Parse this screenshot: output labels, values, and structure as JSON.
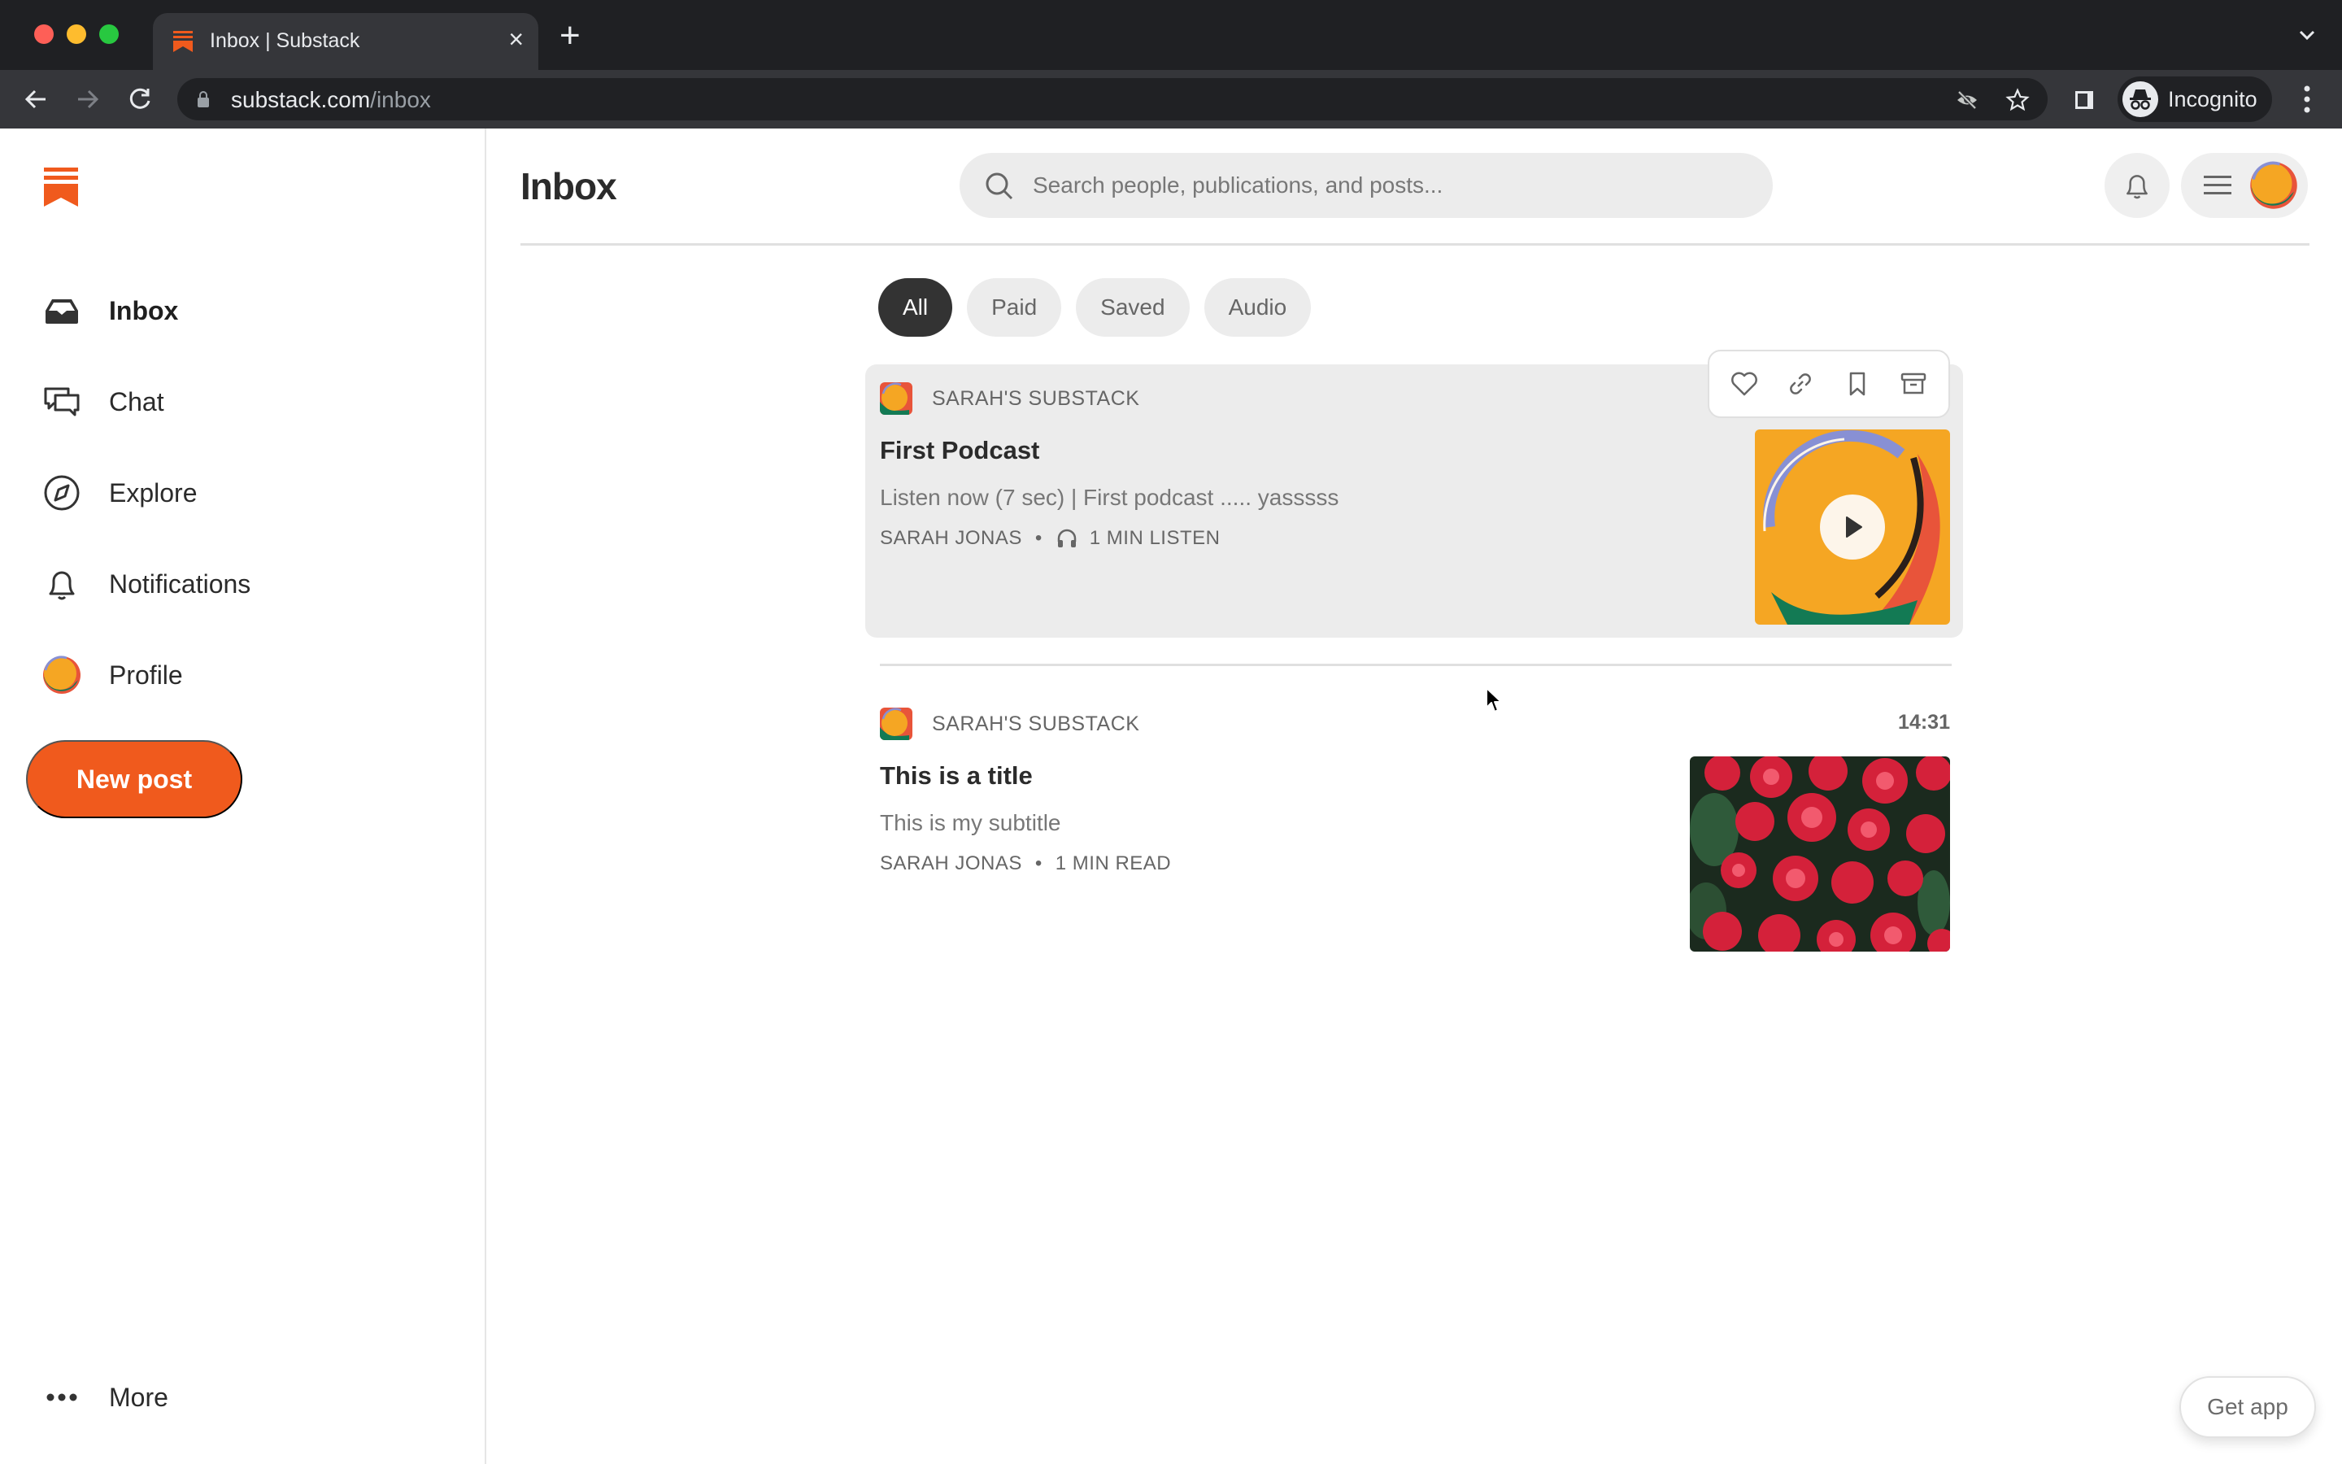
{
  "browser": {
    "tab_title": "Inbox | Substack",
    "url_host": "substack.com",
    "url_path": "/inbox",
    "profile_label": "Incognito"
  },
  "colors": {
    "brand": "#f05a1d",
    "chip_active": "#333333"
  },
  "sidebar": {
    "items": [
      {
        "label": "Inbox",
        "icon": "inbox-icon",
        "active": true
      },
      {
        "label": "Chat",
        "icon": "chat-icon"
      },
      {
        "label": "Explore",
        "icon": "compass-icon"
      },
      {
        "label": "Notifications",
        "icon": "bell-icon"
      },
      {
        "label": "Profile",
        "icon": "avatar"
      }
    ],
    "new_post_label": "New post",
    "more_label": "More"
  },
  "header": {
    "title": "Inbox",
    "search_placeholder": "Search people, publications, and posts..."
  },
  "filters": [
    {
      "label": "All",
      "active": true
    },
    {
      "label": "Paid"
    },
    {
      "label": "Saved"
    },
    {
      "label": "Audio"
    }
  ],
  "posts": [
    {
      "publication": "SARAH'S SUBSTACK",
      "title": "First Podcast",
      "subtitle": "Listen now (7 sec) | First podcast ..... yasssss",
      "author": "SARAH JONAS",
      "duration": "1 MIN LISTEN",
      "type": "audio",
      "actions": [
        "like",
        "copy-link",
        "save",
        "archive"
      ]
    },
    {
      "publication": "SARAH'S SUBSTACK",
      "time": "14:31",
      "title": "This is a title",
      "subtitle": "This is my subtitle",
      "author": "SARAH JONAS",
      "duration": "1 MIN READ",
      "type": "article"
    }
  ],
  "get_app_label": "Get app"
}
